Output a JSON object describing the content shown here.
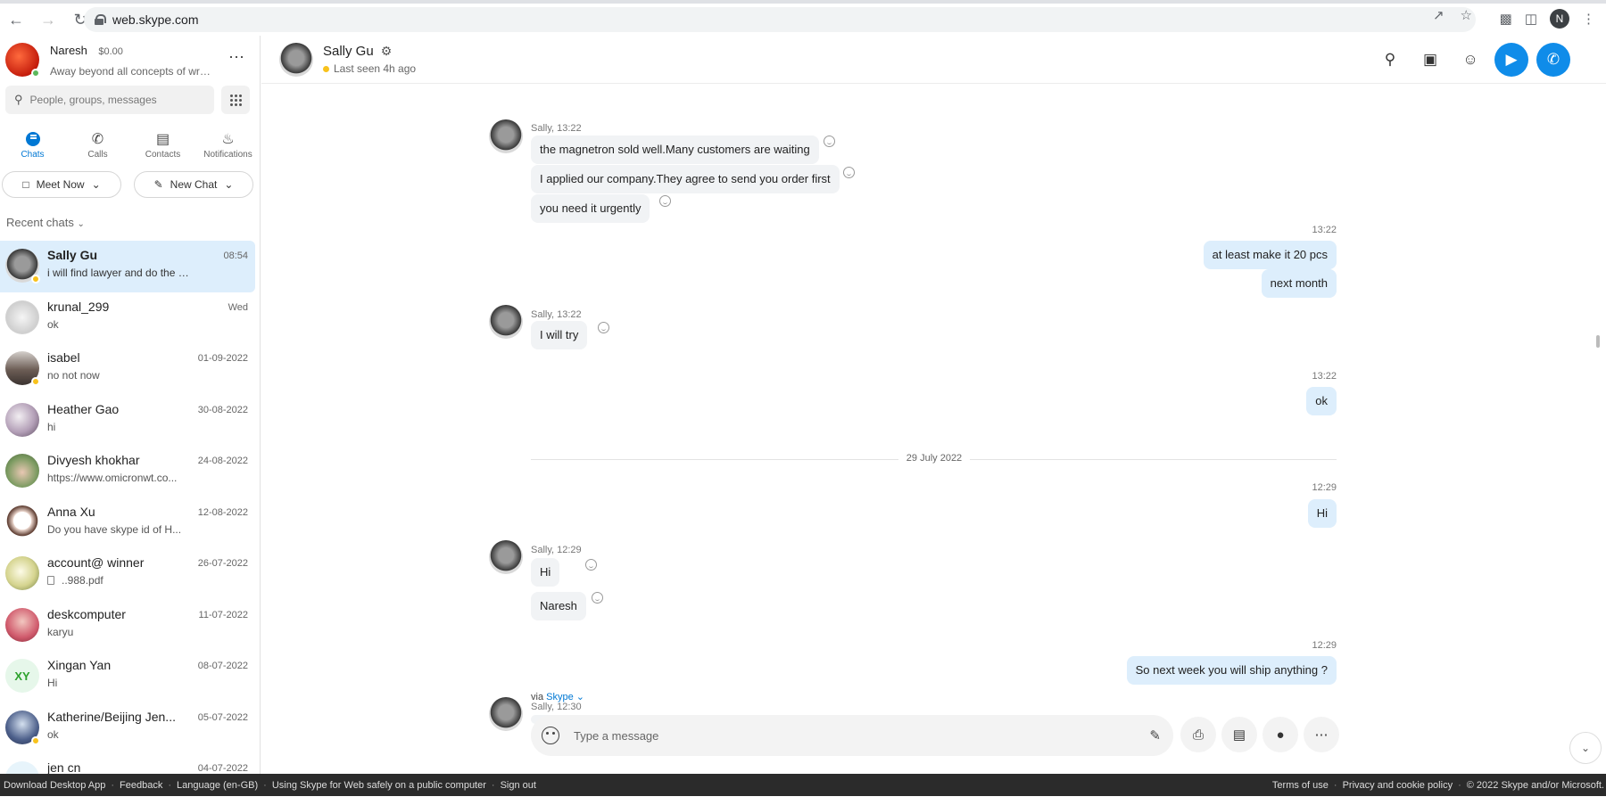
{
  "browser": {
    "url": "web.skype.com",
    "profile_initial": "N"
  },
  "profile": {
    "name": "Naresh",
    "balance": "$0.00",
    "mood": "Away beyond all concepts of wrong"
  },
  "search": {
    "placeholder": "People, groups, messages"
  },
  "nav_tabs": [
    {
      "label": "Chats",
      "icon": "chat-icon"
    },
    {
      "label": "Calls",
      "icon": "phone-icon"
    },
    {
      "label": "Contacts",
      "icon": "contacts-icon"
    },
    {
      "label": "Notifications",
      "icon": "bell-icon"
    }
  ],
  "actions": {
    "meet_now": "Meet Now",
    "new_chat": "New Chat"
  },
  "recent_chats_label": "Recent chats",
  "chats": [
    {
      "name": "Sally Gu",
      "time": "08:54",
      "preview": "i will find lawyer and do the the business"
    },
    {
      "name": "krunal_299",
      "time": "Wed",
      "preview": "ok"
    },
    {
      "name": "isabel",
      "time": "01-09-2022",
      "preview": "no not now"
    },
    {
      "name": "Heather Gao",
      "time": "30-08-2022",
      "preview": "hi"
    },
    {
      "name": "Divyesh khokhar",
      "time": "24-08-2022",
      "preview": "https://www.omicronwt.co..."
    },
    {
      "name": "Anna Xu",
      "time": "12-08-2022",
      "preview": "Do you have skype id of H..."
    },
    {
      "name": "account@ winner",
      "time": "26-07-2022",
      "preview": "..988.pdf"
    },
    {
      "name": "deskcomputer",
      "time": "11-07-2022",
      "preview": "karyu"
    },
    {
      "name": "Xingan  Yan",
      "time": "08-07-2022",
      "preview": "Hi",
      "initials": "XY"
    },
    {
      "name": "Katherine/Beijing Jen...",
      "time": "05-07-2022",
      "preview": "ok"
    },
    {
      "name": "jen cn",
      "time": "04-07-2022",
      "preview": ""
    }
  ],
  "conversation": {
    "contact_name": "Sally Gu",
    "last_seen": "Last seen 4h ago",
    "date_separator": "29 July 2022",
    "via_text": "via",
    "via_link": "Skype",
    "composer_placeholder": "Type a message",
    "groups": [
      {
        "meta": "Sally, 13:22",
        "messages": [
          "the magnetron sold well.Many customers are waiting",
          "I applied our company.They agree to send you order first",
          "you need it urgently"
        ]
      },
      {
        "meta": "13:22",
        "messages": [
          "at least make it 20 pcs",
          "next month"
        ]
      },
      {
        "meta": "Sally, 13:22",
        "messages": [
          "I will try"
        ]
      },
      {
        "meta": "13:22",
        "messages": [
          "ok"
        ]
      },
      {
        "meta": "12:29",
        "messages": [
          "Hi"
        ]
      },
      {
        "meta": "Sally, 12:29",
        "messages": [
          "Hi",
          "Naresh"
        ]
      },
      {
        "meta": "12:29",
        "messages": [
          "So next week you will ship anything ?"
        ]
      },
      {
        "meta": "Sally, 12:30",
        "messages": [
          ""
        ]
      }
    ]
  },
  "footer": {
    "links": [
      "Download Desktop App",
      "Feedback",
      "Language (en-GB)",
      "Using Skype for Web safely on a public computer",
      "Sign out"
    ],
    "right_links": [
      "Terms of use",
      "Privacy and cookie policy",
      "© 2022 Skype and/or Microsoft."
    ]
  }
}
